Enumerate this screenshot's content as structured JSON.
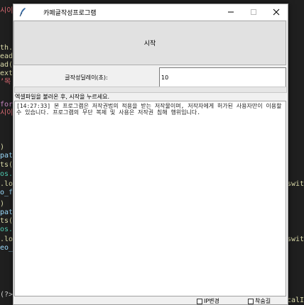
{
  "background_code": {
    "left_fragments": [
      "시이",
      "th.f",
      "eadl",
      "ad()",
      "ext.",
      "’목",
      "for",
      "시이",
      ")",
      "path",
      "ts(p",
      "os.",
      ".low",
      "o_f",
      ")",
      "path",
      "ts(v",
      "os.",
      ".low",
      "eo_f"
    ],
    "right_fragments": [
      "swith",
      "swith"
    ],
    "bottom_fragment": "(?>",
    "bottom_right_fragment": "calIPr"
  },
  "window": {
    "title": "카페글작성프로그램",
    "start_button": "시작",
    "delay_label": "글작성딜레이(초):",
    "delay_value": "10",
    "status_text": "엑셀파일을 불러온 후, 시작을 누르세요.",
    "log_text": "[14:27:33] 본 프로그램은 저작권법의 적용을 받는 저작물이며, 저작자에게 허가된 사용자만이 이용할 수 있습니다. 프로그램의 무단 복제 및 사용은 저작권 침해 행위입니다.",
    "ip_change_label": "IP변경",
    "favorite_label": "착숨길"
  }
}
